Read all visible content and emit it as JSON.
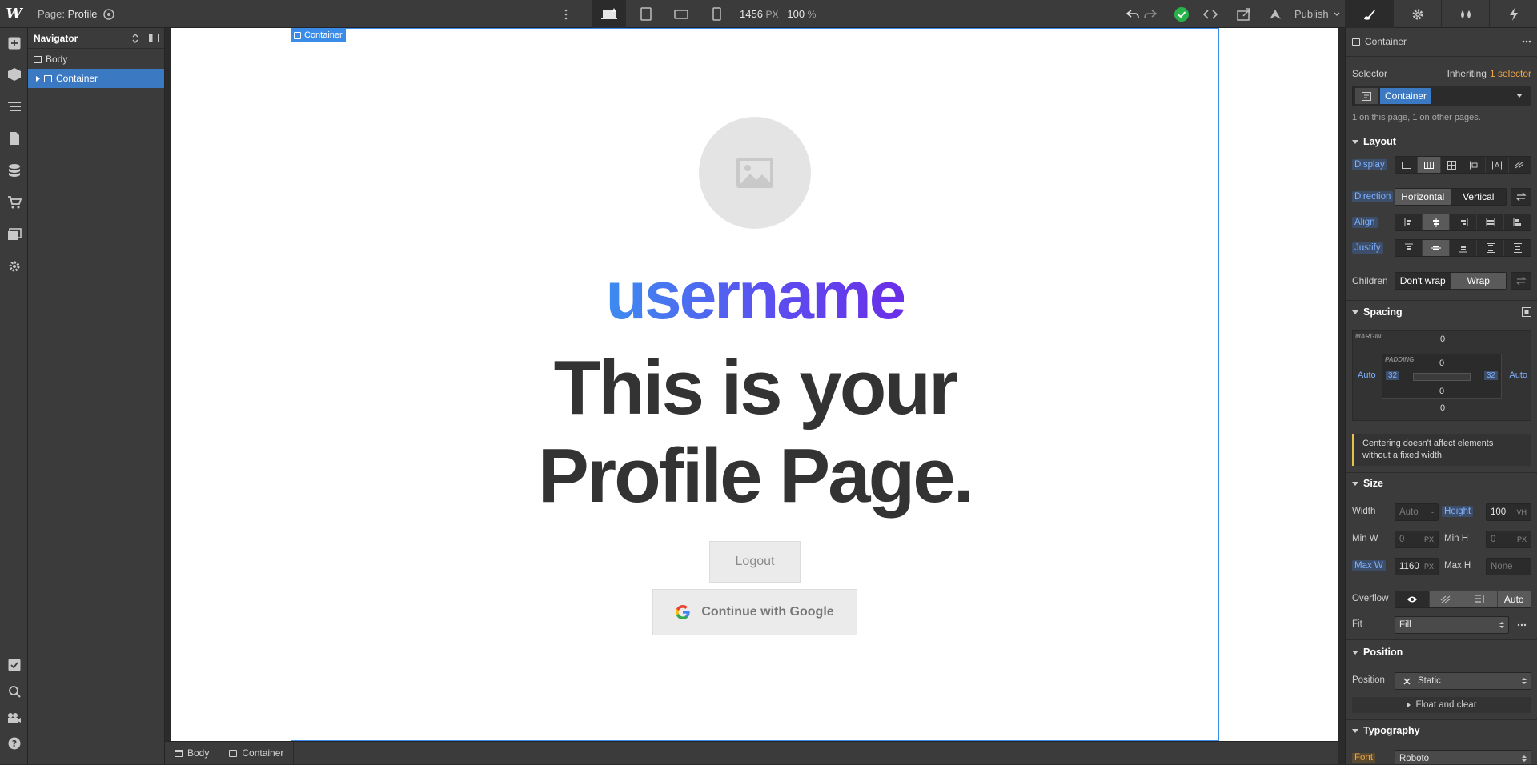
{
  "topbar": {
    "logo": "W",
    "page_prefix": "Page:",
    "page_name": "Profile",
    "canvas_width": "1456",
    "canvas_width_unit": "PX",
    "zoom": "100",
    "zoom_unit": "%",
    "publish_label": "Publish"
  },
  "navigator": {
    "title": "Navigator",
    "items": [
      {
        "label": "Body"
      },
      {
        "label": "Container"
      }
    ]
  },
  "canvas": {
    "container_tag": "Container",
    "username": "username",
    "headline_line1": "This is your",
    "headline_line2": "Profile Page.",
    "logout_label": "Logout",
    "google_label": "Continue with Google",
    "gradient_colors": [
      "#3d8cf0",
      "#6a2ee8"
    ]
  },
  "breadcrumb": {
    "items": [
      {
        "label": "Body"
      },
      {
        "label": "Container"
      }
    ]
  },
  "style_panel": {
    "element_label": "Container",
    "selector_label": "Selector",
    "inheriting_prefix": "Inheriting",
    "inheriting_link": "1 selector",
    "selector_chip": "Container",
    "usage_note": "1 on this page, 1 on other pages.",
    "layout": {
      "title": "Layout",
      "display_label": "Display",
      "direction_label": "Direction",
      "direction_options": [
        "Horizontal",
        "Vertical"
      ],
      "align_label": "Align",
      "justify_label": "Justify",
      "children_label": "Children",
      "children_options": [
        "Don't wrap",
        "Wrap"
      ]
    },
    "spacing": {
      "title": "Spacing",
      "margin_label": "MARGIN",
      "padding_label": "PADDING",
      "margin_top": "0",
      "margin_bottom": "0",
      "margin_left": "Auto",
      "margin_right": "Auto",
      "padding_top": "0",
      "padding_bottom": "0",
      "padding_left": "32",
      "padding_right": "32",
      "note": "Centering doesn't affect elements without a fixed width."
    },
    "size": {
      "title": "Size",
      "width_label": "Width",
      "width_value": "Auto",
      "width_unit": "-",
      "height_label": "Height",
      "height_value": "100",
      "height_unit": "VH",
      "minw_label": "Min W",
      "minw_value": "0",
      "minw_unit": "PX",
      "minh_label": "Min H",
      "minh_value": "0",
      "minh_unit": "PX",
      "maxw_label": "Max W",
      "maxw_value": "1160",
      "maxw_unit": "PX",
      "maxh_label": "Max H",
      "maxh_value": "None",
      "maxh_unit": "-",
      "overflow_label": "Overflow",
      "overflow_auto": "Auto",
      "fit_label": "Fit",
      "fit_value": "Fill"
    },
    "position": {
      "title": "Position",
      "position_label": "Position",
      "position_value": "Static",
      "float_label": "Float and clear"
    },
    "typography": {
      "title": "Typography",
      "font_label": "Font",
      "font_value": "Roboto"
    }
  }
}
